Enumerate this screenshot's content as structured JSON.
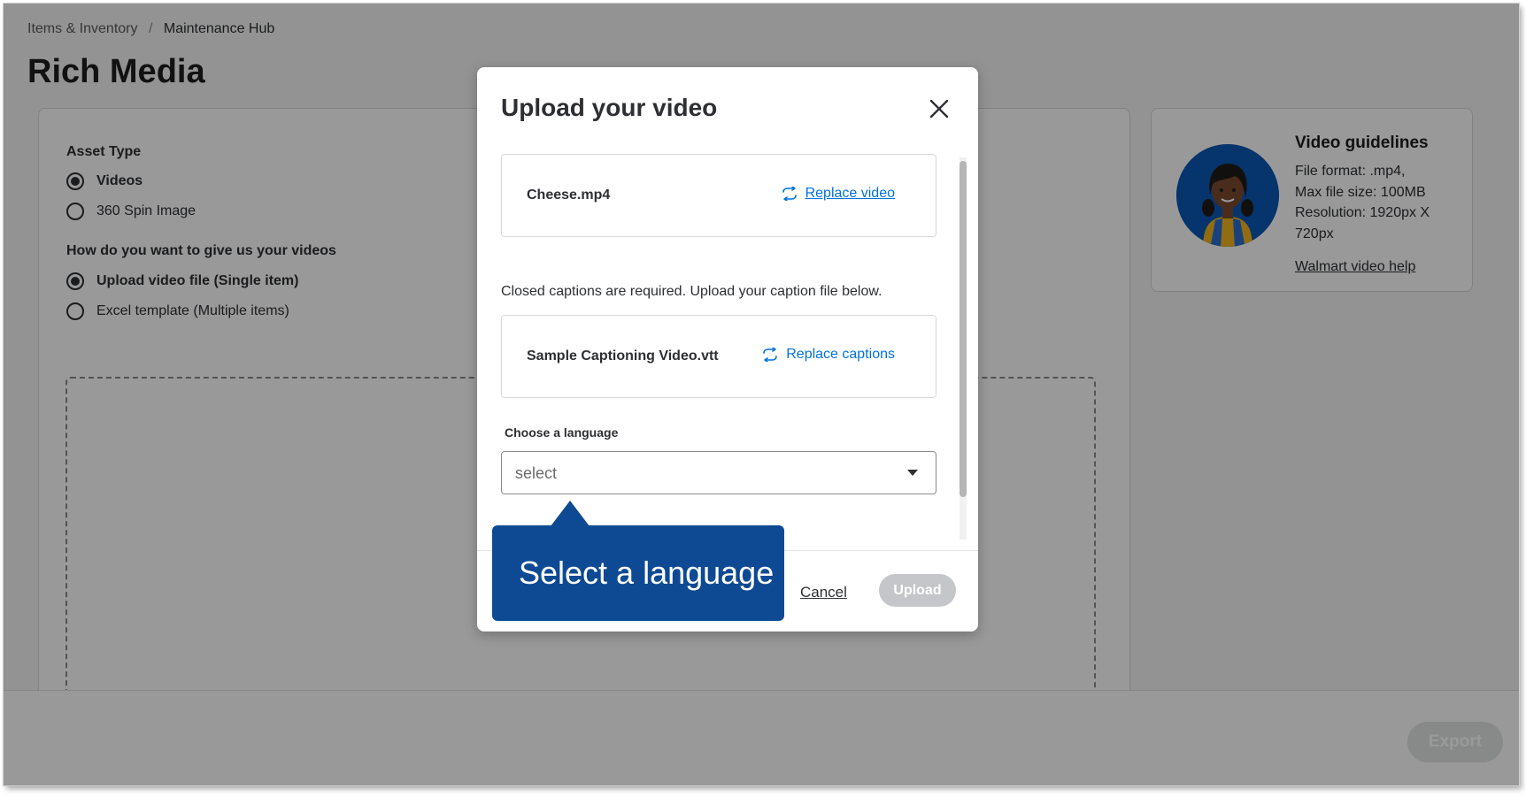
{
  "breadcrumb": {
    "parent": "Items & Inventory",
    "separator": "/",
    "current": "Maintenance Hub"
  },
  "page_title": "Rich Media",
  "form": {
    "asset_type_label": "Asset Type",
    "asset_options": [
      {
        "label": "Videos",
        "checked": true
      },
      {
        "label": "360 Spin Image",
        "checked": false
      }
    ],
    "method_label": "How do you want to give us your videos",
    "method_options": [
      {
        "label": "Upload video file (Single item)",
        "checked": true
      },
      {
        "label": "Excel template (Multiple items)",
        "checked": false
      }
    ]
  },
  "guidelines": {
    "title": "Video guidelines",
    "lines": [
      "File format: .mp4,",
      "Max file size: 100MB",
      "Resolution: 1920px X",
      "720px"
    ],
    "help_link": "Walmart video help",
    "avatar_icon": "associate-avatar-icon"
  },
  "footer": {
    "export_label": "Export"
  },
  "modal": {
    "title": "Upload your video",
    "close_icon": "close-icon",
    "video_file": {
      "name": "Cheese.mp4",
      "action": "Replace video",
      "icon": "replace-icon"
    },
    "caption_notice": "Closed captions are required. Upload your caption file below.",
    "caption_file": {
      "name": "Sample Captioning Video.vtt",
      "action": "Replace captions",
      "icon": "replace-icon"
    },
    "language": {
      "label": "Choose a language",
      "placeholder": "select"
    },
    "cancel_label": "Cancel",
    "upload_label": "Upload"
  },
  "tooltip": {
    "text": "Select a language"
  },
  "colors": {
    "accent": "#0071dc",
    "tooltip_bg": "#0d4a93",
    "avatar_bg": "#0a58b5",
    "disabled_button": "#c4c6c9"
  }
}
